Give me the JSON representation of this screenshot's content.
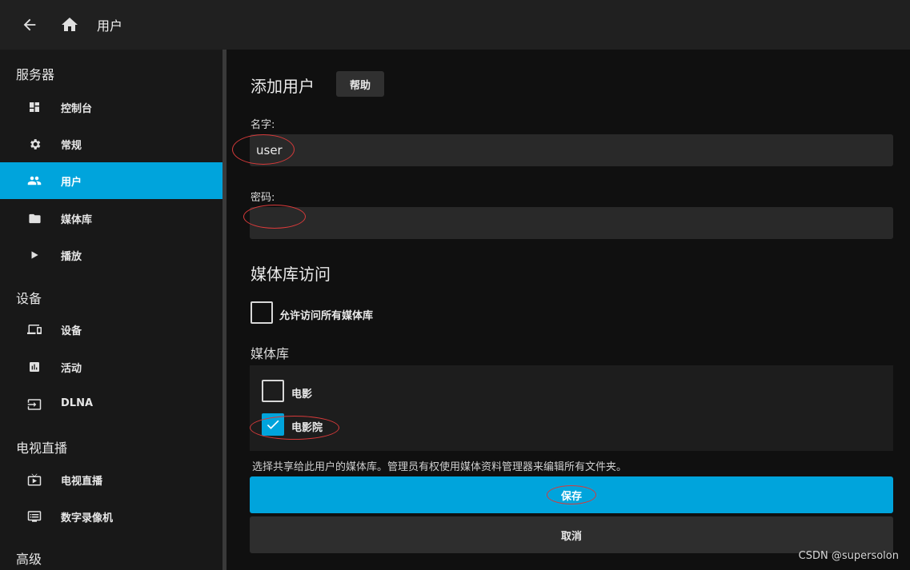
{
  "header": {
    "title": "用户",
    "back_icon": "arrow-left-icon",
    "home_icon": "home-icon"
  },
  "sidebar": {
    "sections": [
      {
        "title": "服务器"
      },
      {
        "title": "设备"
      },
      {
        "title": "电视直播"
      },
      {
        "title": "高级"
      }
    ],
    "items": [
      {
        "label": "控制台",
        "icon": "dashboard-icon"
      },
      {
        "label": "常规",
        "icon": "gear-icon"
      },
      {
        "label": "用户",
        "icon": "people-icon",
        "active": true
      },
      {
        "label": "媒体库",
        "icon": "folder-icon"
      },
      {
        "label": "播放",
        "icon": "play-icon"
      },
      {
        "label": "设备",
        "icon": "devices-icon"
      },
      {
        "label": "活动",
        "icon": "chart-icon"
      },
      {
        "label": "DLNA",
        "icon": "input-icon"
      },
      {
        "label": "电视直播",
        "icon": "live-tv-icon"
      },
      {
        "label": "数字录像机",
        "icon": "dvr-icon"
      }
    ]
  },
  "form": {
    "heading": "添加用户",
    "help_label": "帮助",
    "name_label": "名字:",
    "name_value": "user",
    "password_label": "密码:",
    "password_value": "",
    "library_access_heading": "媒体库访问",
    "allow_all_label": "允许访问所有媒体库",
    "allow_all_checked": false,
    "libraries_heading": "媒体库",
    "libraries": [
      {
        "label": "电影",
        "checked": false
      },
      {
        "label": "电影院",
        "checked": true
      }
    ],
    "description": "选择共享给此用户的媒体库。管理员有权使用媒体资料管理器来编辑所有文件夹。",
    "save_label": "保存",
    "cancel_label": "取消"
  },
  "watermark": "CSDN @supersolon",
  "colors": {
    "accent": "#00a4dc",
    "annotation": "#d83a3a"
  }
}
